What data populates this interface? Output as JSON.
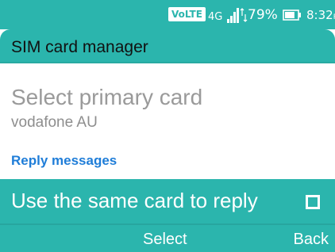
{
  "status_bar": {
    "volte": "VoLTE",
    "network_type": "4G",
    "battery_percent": "79%",
    "battery_level": 0.79,
    "time": "8:32",
    "time_suffix": "PM",
    "signal_icon": "signal-bars-icon",
    "battery_icon": "battery-icon"
  },
  "header": {
    "title": "SIM card manager"
  },
  "primary_card": {
    "title": "Select primary card",
    "value": "vodafone AU"
  },
  "reply_section": {
    "header": "Reply messages",
    "option_label": "Use the same card to reply",
    "checked": false
  },
  "softkeys": {
    "center": "Select",
    "right": "Back"
  },
  "colors": {
    "accent": "#2bb5ad",
    "link_blue": "#1f7dd8",
    "muted_text": "#9a9a9a"
  }
}
